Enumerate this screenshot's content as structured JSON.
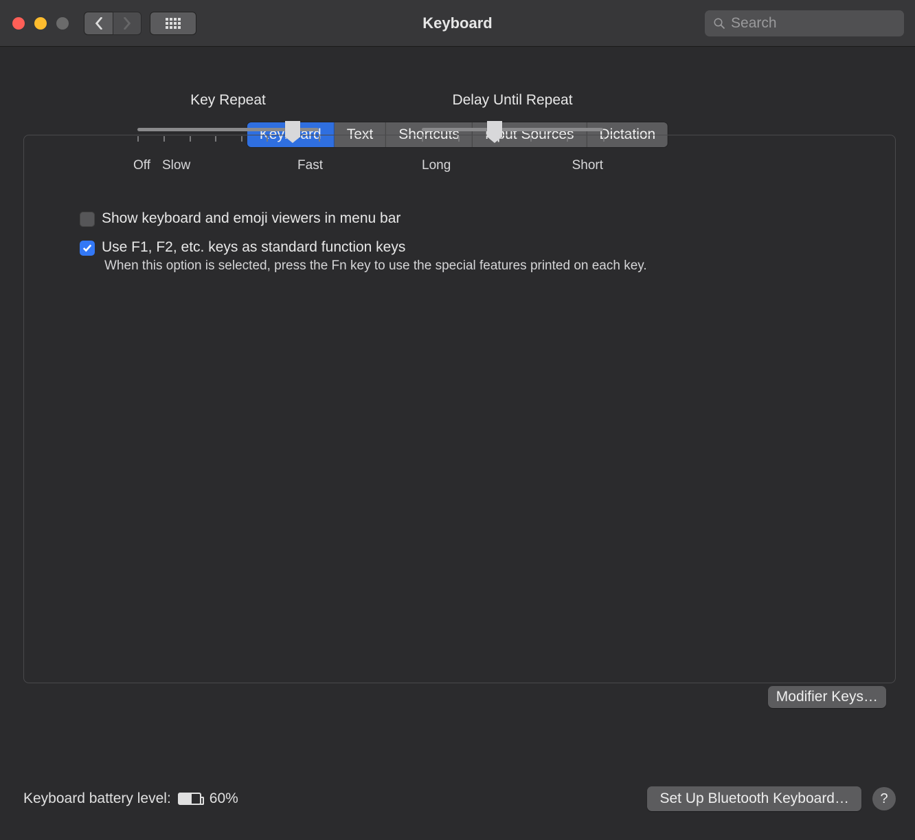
{
  "window": {
    "title": "Keyboard",
    "search_placeholder": "Search"
  },
  "tabs": {
    "keyboard": "Keyboard",
    "text": "Text",
    "shortcuts": "Shortcuts",
    "input_sources": "Input Sources",
    "dictation": "Dictation",
    "active": "keyboard"
  },
  "sliders": {
    "key_repeat": {
      "label": "Key Repeat",
      "min_label": "Off",
      "slow_label": "Slow",
      "max_label": "Fast",
      "tick_count": 8,
      "value_index": 6
    },
    "delay_until_repeat": {
      "label": "Delay Until Repeat",
      "min_label": "Long",
      "max_label": "Short",
      "tick_count": 6,
      "value_index": 2
    }
  },
  "checkboxes": {
    "show_viewers": {
      "label": "Show keyboard and emoji viewers in menu bar",
      "checked": false
    },
    "function_keys": {
      "label": "Use F1, F2, etc. keys as standard function keys",
      "sub_label": "When this option is selected, press the Fn key to use the special features printed on each key.",
      "checked": true
    }
  },
  "buttons": {
    "modifier_keys": "Modifier Keys…",
    "bluetooth": "Set Up Bluetooth Keyboard…",
    "help": "?"
  },
  "battery": {
    "label": "Keyboard battery level:",
    "percent_text": "60%",
    "percent_value": 60
  }
}
